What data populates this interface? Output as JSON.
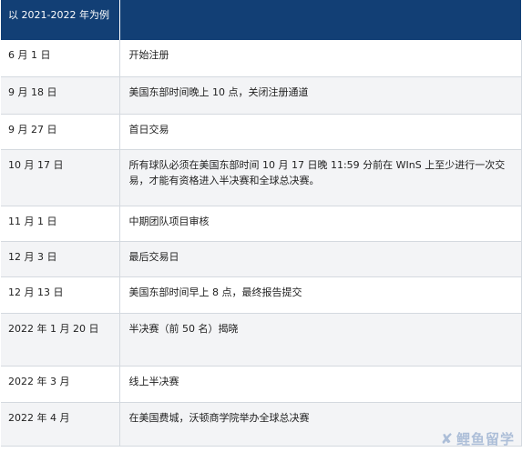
{
  "header": {
    "col1": "以 2021-2022 年为例",
    "col2": ""
  },
  "rows": [
    {
      "date": "6 月 1 日",
      "event": "开始注册"
    },
    {
      "date": "9 月 18 日",
      "event": "美国东部时间晚上 10 点，关闭注册通道"
    },
    {
      "date": "9 月 27 日",
      "event": "首日交易"
    },
    {
      "date": "10 月 17 日",
      "event": "所有球队必须在美国东部时间 10 月 17 日晚 11:59 分前在 WInS 上至少进行一次交易，才能有资格进入半决赛和全球总决赛。"
    },
    {
      "date": "11 月 1 日",
      "event": "中期团队项目审核"
    },
    {
      "date": "12 月 3 日",
      "event": "最后交易日"
    },
    {
      "date": "12 月 13 日",
      "event": "美国东部时间早上 8 点，最终报告提交"
    },
    {
      "date": "2022 年 1 月 20 日",
      "event": "半决赛（前 50 名）揭晓"
    },
    {
      "date": "2022 年 3 月",
      "event": "线上半决赛"
    },
    {
      "date": "2022 年 4 月",
      "event": "在美国费城，沃顿商学院举办全球总决赛"
    }
  ],
  "watermark": {
    "text": "鲤鱼留学",
    "icon": "fish-icon"
  }
}
